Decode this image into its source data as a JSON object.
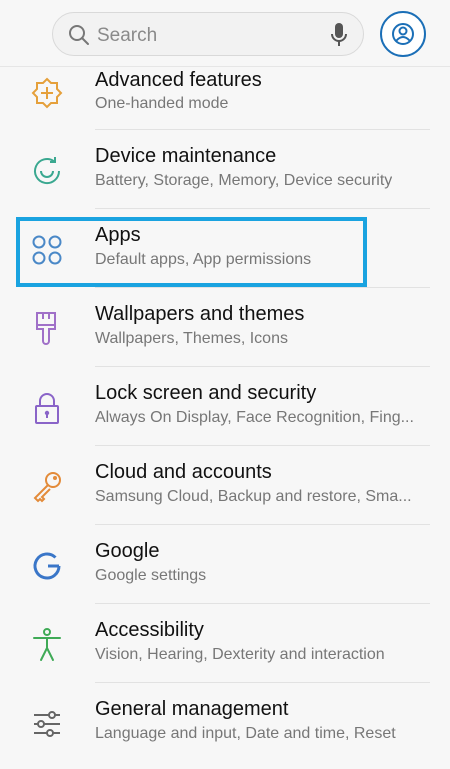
{
  "search": {
    "placeholder": "Search"
  },
  "items": [
    {
      "title": "Advanced features",
      "subtitle": "One-handed mode",
      "icon": "advanced-features-icon",
      "color": "#e5a03b"
    },
    {
      "title": "Device maintenance",
      "subtitle": "Battery, Storage, Memory, Device security",
      "icon": "device-maintenance-icon",
      "color": "#3aa890"
    },
    {
      "title": "Apps",
      "subtitle": "Default apps, App permissions",
      "icon": "apps-icon",
      "color": "#4a88c7"
    },
    {
      "title": "Wallpapers and themes",
      "subtitle": "Wallpapers, Themes, Icons",
      "icon": "paint-brush-icon",
      "color": "#a070c8"
    },
    {
      "title": "Lock screen and security",
      "subtitle": "Always On Display, Face Recognition, Fing...",
      "icon": "lock-icon",
      "color": "#8a64c8"
    },
    {
      "title": "Cloud and accounts",
      "subtitle": "Samsung Cloud, Backup and restore, Sma...",
      "icon": "key-icon",
      "color": "#e38b3a"
    },
    {
      "title": "Google",
      "subtitle": "Google settings",
      "icon": "google-icon",
      "color": "#3a76c8"
    },
    {
      "title": "Accessibility",
      "subtitle": "Vision, Hearing, Dexterity and interaction",
      "icon": "accessibility-icon",
      "color": "#3faa56"
    },
    {
      "title": "General management",
      "subtitle": "Language and input, Date and time, Reset",
      "icon": "sliders-icon",
      "color": "#666666"
    }
  ],
  "highlight_color": "#1aa3e0"
}
